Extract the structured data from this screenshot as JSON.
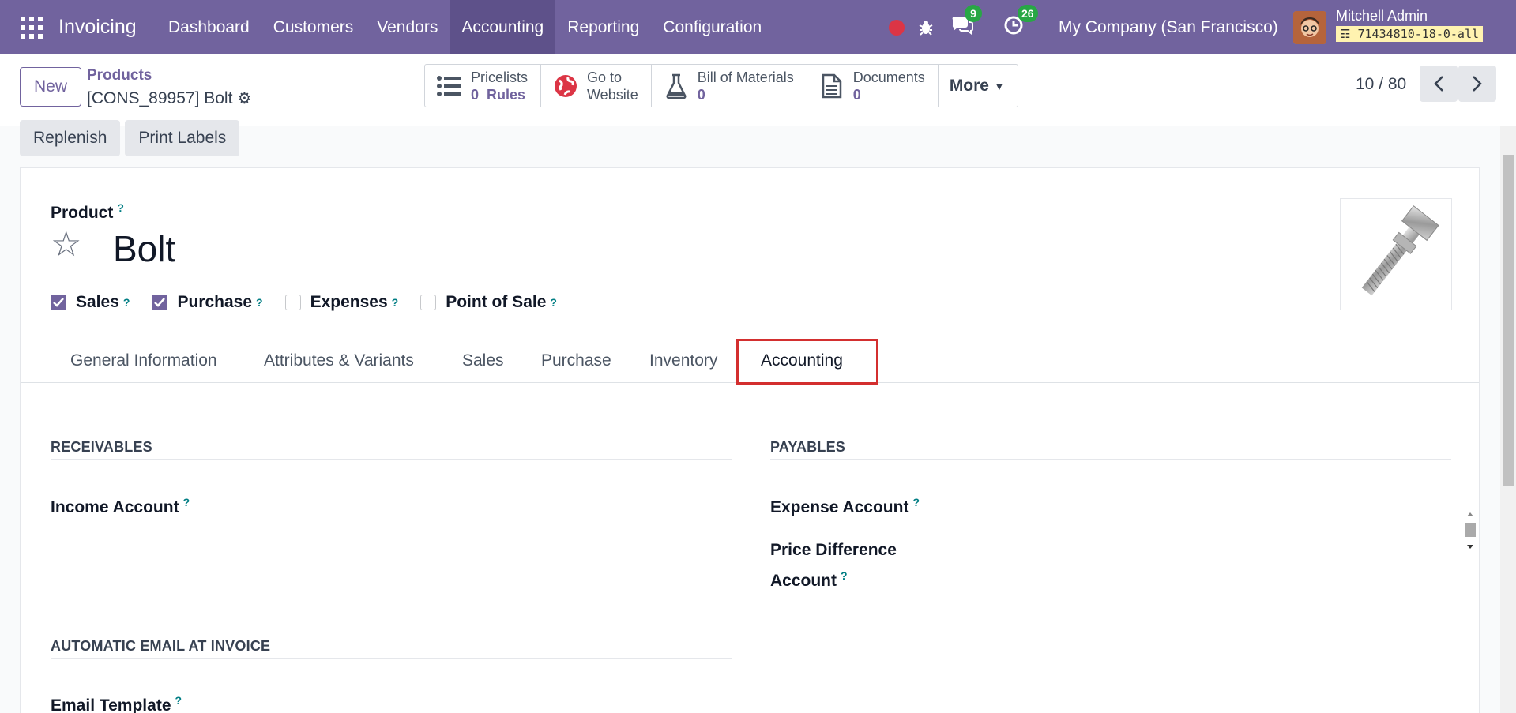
{
  "navbar": {
    "brand": "Invoicing",
    "menu": [
      "Dashboard",
      "Customers",
      "Vendors",
      "Accounting",
      "Reporting",
      "Configuration"
    ],
    "active_menu": "Accounting",
    "chat_badge": "9",
    "activity_badge": "26",
    "company": "My Company (San Francisco)",
    "user_name": "Mitchell Admin",
    "db_name": "71434810-18-0-all"
  },
  "control": {
    "new_label": "New",
    "breadcrumb_parent": "Products",
    "breadcrumb_current": "[CONS_89957] Bolt",
    "smart_buttons": [
      {
        "line1": "Pricelists",
        "value": "0",
        "line2": "Rules"
      },
      {
        "line1": "Go to",
        "line2": "Website"
      },
      {
        "line1": "Bill of Materials",
        "value": "0"
      },
      {
        "line1": "Documents",
        "value": "0"
      }
    ],
    "more_label": "More",
    "pager": "10 / 80"
  },
  "actions": {
    "replenish": "Replenish",
    "print_labels": "Print Labels"
  },
  "form": {
    "product_label": "Product",
    "product_name": "Bolt",
    "help_mark": "?",
    "checkboxes": [
      {
        "label": "Sales",
        "checked": true
      },
      {
        "label": "Purchase",
        "checked": true
      },
      {
        "label": "Expenses",
        "checked": false
      },
      {
        "label": "Point of Sale",
        "checked": false
      }
    ],
    "tabs": [
      "General Information",
      "Attributes & Variants",
      "Sales",
      "Purchase",
      "Inventory",
      "Accounting"
    ],
    "active_tab": "Accounting",
    "receivables_title": "RECEIVABLES",
    "income_account": "Income Account",
    "payables_title": "PAYABLES",
    "expense_account": "Expense Account",
    "price_diff_line1": "Price Difference",
    "price_diff_line2": "Account",
    "auto_email_title": "AUTOMATIC EMAIL AT INVOICE",
    "email_template": "Email Template"
  },
  "colors": {
    "brand": "#71639e",
    "highlight": "#d32f2f",
    "badge": "#28a745"
  }
}
